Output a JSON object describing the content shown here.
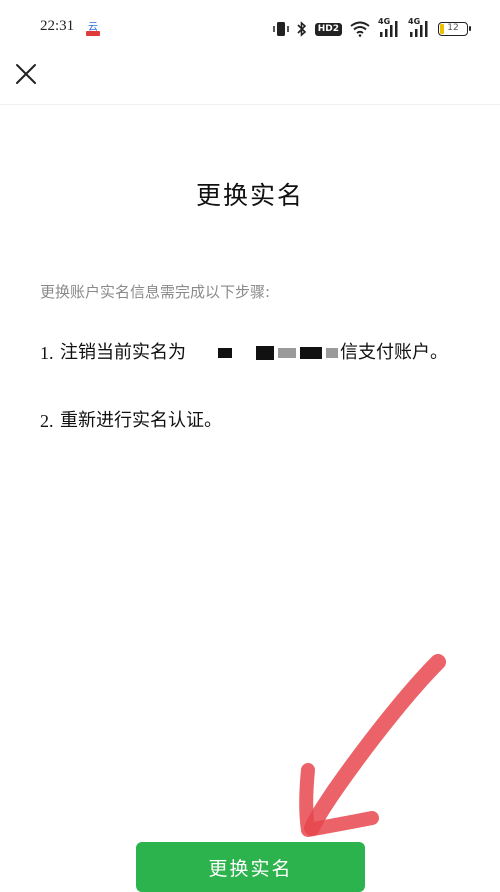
{
  "status_bar": {
    "time": "22:31",
    "network_4g_1": "4G",
    "network_4g_2": "4G",
    "hd_badge": "HD2",
    "battery_level": "12"
  },
  "nav": {
    "close_icon": "close-icon"
  },
  "page": {
    "title": "更换实名",
    "intro": "更换账户实名信息需完成以下步骤:",
    "steps": [
      {
        "num": "1.",
        "text_before": "注销当前实名为",
        "text_after": "信支付账户。"
      },
      {
        "num": "2.",
        "text": "重新进行实名认证。"
      }
    ]
  },
  "button": {
    "label": "更换实名"
  },
  "colors": {
    "primary_green": "#2db34d",
    "annotation_red": "#e8474f"
  }
}
